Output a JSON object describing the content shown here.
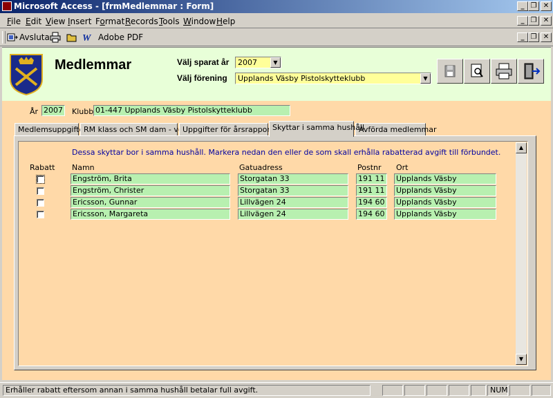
{
  "window": {
    "title": "Microsoft Access - [frmMedlemmar : Form]",
    "minimize": "_",
    "restore": "❐",
    "close": "✕"
  },
  "menu": [
    {
      "label": "File",
      "key": "F"
    },
    {
      "label": "Edit",
      "key": "E"
    },
    {
      "label": "View",
      "key": "V"
    },
    {
      "label": "Insert",
      "key": "I"
    },
    {
      "label": "Format",
      "key": "o"
    },
    {
      "label": "Records",
      "key": "R"
    },
    {
      "label": "Tools",
      "key": "T"
    },
    {
      "label": "Window",
      "key": "W"
    },
    {
      "label": "Help",
      "key": "H"
    }
  ],
  "toolbar": {
    "exit_label": "Avsluta",
    "pdf_label": "Adobe PDF",
    "icons": [
      "exit-icon",
      "print-icon",
      "open-folder-icon",
      "word-icon"
    ]
  },
  "header": {
    "title": "Medlemmar",
    "year_label": "Välj sparat år",
    "year_value": "2007",
    "club_label": "Välj förening",
    "club_value": "Upplands Väsby Pistolskytteklubb",
    "buttons": [
      "save-icon",
      "preview-icon",
      "print-icon",
      "exit-door-icon"
    ]
  },
  "record": {
    "year_label": "År",
    "year_value": "2007",
    "club_label": "Klubb",
    "club_value": "01-447 Upplands Väsby Pistolskytteklubb"
  },
  "tabs": [
    "Medlemsuppgifter",
    "RM klass och SM dam - vet",
    "Uppgifter för årsrapporten",
    "Skyttar i samma hushåll",
    "Avförda medlemmar"
  ],
  "active_tab": 3,
  "household": {
    "instruction": "Dessa skyttar bor i samma hushåll. Markera nedan den eller de som skall erhålla rabatterad avgift till förbundet.",
    "columns": {
      "rabatt": "Rabatt",
      "namn": "Namn",
      "gatuadress": "Gatuadress",
      "postnr": "Postnr",
      "ort": "Ort"
    },
    "rows": [
      {
        "rabatt": false,
        "namn": "Engström, Brita",
        "gatuadress": "Storgatan 33",
        "postnr": "191 11",
        "ort": "Upplands Väsby"
      },
      {
        "rabatt": false,
        "namn": "Engström, Christer",
        "gatuadress": "Storgatan 33",
        "postnr": "191 11",
        "ort": "Upplands Väsby"
      },
      {
        "rabatt": false,
        "namn": "Ericsson, Gunnar",
        "gatuadress": "Lillvägen 24",
        "postnr": "194 60",
        "ort": "Upplands Väsby"
      },
      {
        "rabatt": false,
        "namn": "Ericsson, Margareta",
        "gatuadress": "Lillvägen 24",
        "postnr": "194 60",
        "ort": "Upplands Väsby"
      }
    ]
  },
  "statusbar": {
    "message": "Erhåller rabatt eftersom annan i samma hushåll betalar full avgift.",
    "num": "NUM"
  },
  "colors": {
    "header_bg": "#e8ffd8",
    "detail_bg": "#ffd9a8",
    "field_bg": "#b8f0b0",
    "combo_bg": "#ffff99",
    "instruction_text": "#0000a0"
  }
}
